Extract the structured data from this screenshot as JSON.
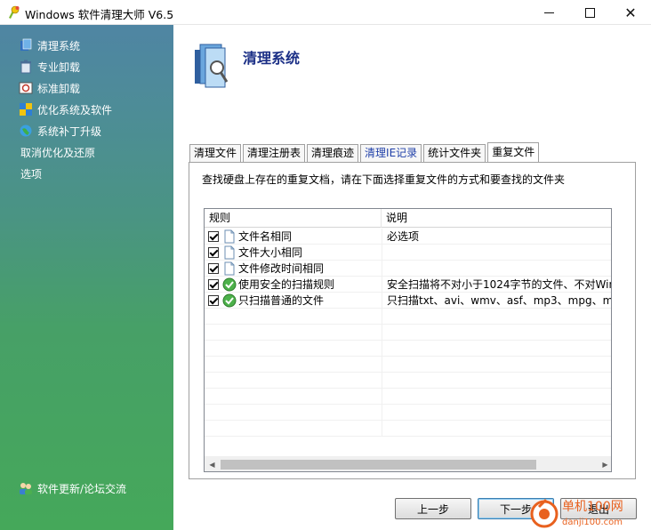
{
  "window": {
    "title": "Windows 软件清理大师 V6.5"
  },
  "sidebar": {
    "items": [
      {
        "label": "清理系统",
        "icon": "clean-icon"
      },
      {
        "label": "专业卸载",
        "icon": "uninstall-icon"
      },
      {
        "label": "标准卸载",
        "icon": "standard-uninstall-icon"
      },
      {
        "label": "优化系统及软件",
        "icon": "optimize-icon"
      },
      {
        "label": "系统补丁升级",
        "icon": "globe-icon"
      },
      {
        "label": "取消优化及还原"
      },
      {
        "label": "选项"
      }
    ],
    "footer": {
      "label": "软件更新/论坛交流",
      "icon": "users-icon"
    }
  },
  "main": {
    "title": "清理系统",
    "tabs": [
      "清理文件",
      "清理注册表",
      "清理痕迹",
      "清理IE记录",
      "统计文件夹",
      "重复文件"
    ],
    "active_tab": "重复文件",
    "description": "查找硬盘上存在的重复文档，请在下面选择重复文件的方式和要查找的文件夹",
    "list": {
      "columns": [
        "规则",
        "说明"
      ],
      "rows": [
        {
          "rule": "文件名相同",
          "desc": "必选项",
          "checked": true,
          "icon": "document-icon"
        },
        {
          "rule": "文件大小相同",
          "desc": "",
          "checked": true,
          "icon": "document-icon"
        },
        {
          "rule": "文件修改时间相同",
          "desc": "",
          "checked": true,
          "icon": "document-icon"
        },
        {
          "rule": "使用安全的扫描规则",
          "desc": "安全扫描将不对小于1024字节的文件、不对Win",
          "checked": true,
          "icon": "green-check-icon"
        },
        {
          "rule": "只扫描普通的文件",
          "desc": "只扫描txt、avi、wmv、asf、mp3、mpg、mp",
          "checked": true,
          "icon": "green-check-icon"
        }
      ]
    },
    "buttons": {
      "prev": "上一步",
      "next": "下一步",
      "exit": "退出"
    }
  },
  "watermark": {
    "text": "单机100网",
    "sub": "danji100.com"
  },
  "colors": {
    "title_blue": "#1b2f86",
    "sidebar_top": "#4f85a3",
    "sidebar_bottom": "#45a85a"
  }
}
